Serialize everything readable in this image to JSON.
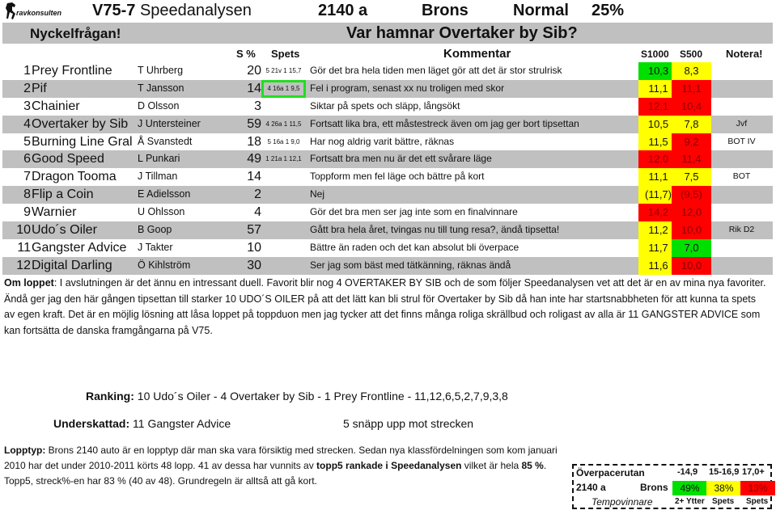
{
  "header": {
    "logo_text": "ravkonsulten",
    "race": "V75-7",
    "title": "Speedanalysen",
    "distance": "2140 a",
    "class": "Brons",
    "type": "Normal",
    "percent": "25%"
  },
  "question": {
    "label": "Nyckelfrågan!",
    "text": "Var hamnar Overtaker by Sib?"
  },
  "columns": {
    "s_pct": "S %",
    "spets": "Spets",
    "kommentar": "Kommentar",
    "s1000": "S1000",
    "s500": "S500",
    "notera": "Notera!"
  },
  "colors": {
    "green": "#00e000",
    "yellow": "#ffff00",
    "red": "#ff0000",
    "row_gray": "#c0c0c0",
    "highlight": "#22dd22"
  },
  "rows": [
    {
      "num": "1",
      "name": "Prey Frontline",
      "driver": "T Uhrberg",
      "s_pct": "20",
      "spets": "5 21v 1 15,7",
      "komm": "Gör det bra hela tiden men läget gör att det är stor strulrisk",
      "s1000": "10,3",
      "s1000_color": "g",
      "s500": "8,3",
      "s500_color": "y",
      "note": ""
    },
    {
      "num": "2",
      "name": "Pif",
      "driver": "T Jansson",
      "s_pct": "14",
      "spets": "4 16a 1  9,5",
      "komm": "Fel i program, senast xx nu troligen med skor",
      "s1000": "11,1",
      "s1000_color": "y",
      "s500": "11,1",
      "s500_color": "r",
      "note": ""
    },
    {
      "num": "3",
      "name": "Chainier",
      "driver": "D Olsson",
      "s_pct": "3",
      "spets": "",
      "komm": "Siktar på spets och släpp, långsökt",
      "s1000": "12,1",
      "s1000_color": "r",
      "s500": "10,4",
      "s500_color": "r",
      "note": ""
    },
    {
      "num": "4",
      "name": "Overtaker by Sib",
      "driver": "J Untersteiner",
      "s_pct": "59",
      "spets": "4 26a 1 11,5",
      "komm": "Fortsatt lika bra, ett måstestreck även om jag ger bort tipsettan",
      "s1000": "10,5",
      "s1000_color": "y",
      "s500": "7,8",
      "s500_color": "y",
      "note": "Jvf"
    },
    {
      "num": "5",
      "name": "Burning Line Gral",
      "driver": "Å Svanstedt",
      "s_pct": "18",
      "spets": "5 16a 1  9,0",
      "komm": "Har nog aldrig varit bättre, räknas",
      "s1000": "11,5",
      "s1000_color": "y",
      "s500": "9,2",
      "s500_color": "r",
      "note": "BOT IV"
    },
    {
      "num": "6",
      "name": "Good Speed",
      "driver": "L Punkari",
      "s_pct": "49",
      "spets": "1 21a 1 12,1",
      "komm": "Fortsatt bra men nu är det ett svårare läge",
      "s1000": "12,0",
      "s1000_color": "r",
      "s500": "11,4",
      "s500_color": "r",
      "note": ""
    },
    {
      "num": "7",
      "name": "Dragon Tooma",
      "driver": "J Tillman",
      "s_pct": "14",
      "spets": "",
      "komm": "Toppform men fel läge och bättre på kort",
      "s1000": "11,1",
      "s1000_color": "y",
      "s500": "7,5",
      "s500_color": "y",
      "note": "BOT"
    },
    {
      "num": "8",
      "name": "Flip a Coin",
      "driver": "E Adielsson",
      "s_pct": "2",
      "spets": "",
      "komm": "Nej",
      "s1000": "(11,7)",
      "s1000_color": "y",
      "s500": "(9,5)",
      "s500_color": "r",
      "note": ""
    },
    {
      "num": "9",
      "name": "Warnier",
      "driver": "U Ohlsson",
      "s_pct": "4",
      "spets": "",
      "komm": "Gör det bra men ser jag inte som en finalvinnare",
      "s1000": "14,2",
      "s1000_color": "r",
      "s500": "12,0",
      "s500_color": "r",
      "note": ""
    },
    {
      "num": "10",
      "name": "Udo´s Oiler",
      "driver": "B Goop",
      "s_pct": "57",
      "spets": "",
      "komm": "Gått bra hela året, tvingas nu till tung resa?, ändå tipsetta!",
      "s1000": "11,2",
      "s1000_color": "y",
      "s500": "10,0",
      "s500_color": "r",
      "note": "Rik D2"
    },
    {
      "num": "11",
      "name": "Gangster Advice",
      "driver": "J Takter",
      "s_pct": "10",
      "spets": "",
      "komm": "Bättre än raden och det kan absolut bli överpace",
      "s1000": "11,7",
      "s1000_color": "y",
      "s500": "7,0",
      "s500_color": "g",
      "note": ""
    },
    {
      "num": "12",
      "name": "Digital Darling",
      "driver": "Ö Kihlström",
      "s_pct": "30",
      "spets": "",
      "komm": "Ser jag som bäst med tätkänning, räknas ändå",
      "s1000": "11,6",
      "s1000_color": "y",
      "s500": "10,0",
      "s500_color": "r",
      "note": ""
    }
  ],
  "om_loppet": {
    "label": "Om loppet",
    "text": ": I avslutningen är det ännu en intressant duell. Favorit blir nog 4 OVERTAKER BY SIB och de som följer Speedanalysen vet att det är en av mina nya favoriter. Ändå ger jag den här gången tipsettan till starker 10 UDO´S OILER på att det lätt kan bli strul för Overtaker by Sib då han inte har startsnabbheten för att kunna ta spets av egen kraft. Det är en möjlig lösning att låsa loppet på toppduon men jag tycker att det finns många roliga skrällbud och roligast av alla är 11 GANGSTER ADVICE som kan fortsätta de danska framgångarna på V75."
  },
  "ranking": {
    "label": "Ranking:",
    "text": " 10 Udo´s Oiler - 4 Overtaker by Sib - 1 Prey Frontline - 11,12,6,5,2,7,9,3,8"
  },
  "underskattad": {
    "label": "Underskattad:",
    "text": " 11 Gangster Advice",
    "note": "5 snäpp upp mot strecken"
  },
  "lopptyp": {
    "label": "Lopptyp:",
    "text1": " Brons 2140 auto är en lopptyp där man ska vara försiktig med strecken. Sedan nya klassfördelningen som kom januari 2010 har det under 2010-2011 körts 48 lopp. 41 av dessa har vunnits av ",
    "bold1": "topp5 rankade i Speedanalysen",
    "text2": " vilket är hela ",
    "bold2": "85 %",
    "text3": ". Topp5, streck%-en har 83 % (40 av 48). Grundregeln är alltså att gå kort."
  },
  "overpace": {
    "title": "Överpacerutan",
    "h1": "-14,9",
    "h2": "15-16,9",
    "h3": "17,0+",
    "distance": "2140 a",
    "class": "Brons",
    "v1": "49%",
    "v2": "38%",
    "v3": "13%",
    "tempo": "Tempovinnare",
    "f1": "2+ Ytter",
    "f2": "Spets",
    "f3": "Spets"
  }
}
